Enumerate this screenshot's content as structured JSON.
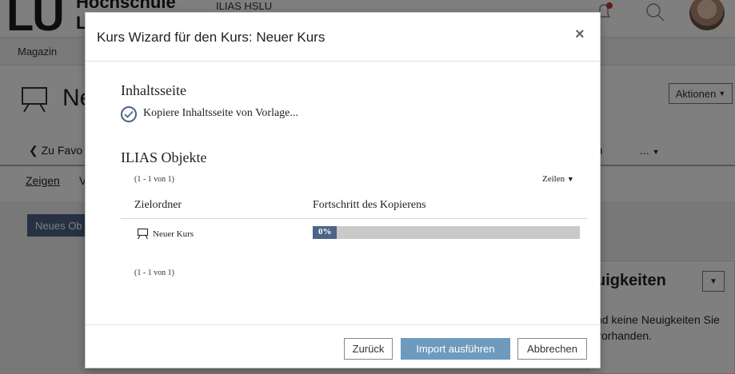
{
  "background": {
    "logo_main": "LU",
    "logo_sub_line1": "Hochschule",
    "logo_sub_line2": "L",
    "topnav_text": "ILIAS HSLU",
    "breadcrumb": "Magazin",
    "course_title": "Ne",
    "actions_label": "Aktionen",
    "tab_back_label": "Zu Favo",
    "tab_partial_label": "en",
    "tab_more_label": "...",
    "subtab_show": "Zeigen",
    "subtab_v": "V",
    "new_object_label": "Neues Ob",
    "news_title": "uigkeiten",
    "news_text": "nd keine Neuigkeiten Sie vorhanden."
  },
  "modal": {
    "title": "Kurs Wizard für den Kurs: Neuer Kurs",
    "close_symbol": "×",
    "content_page_heading": "Inhaltsseite",
    "content_page_status": "Kopiere Inhaltsseite von Vorlage...",
    "objects_heading": "ILIAS Objekte",
    "range_top": "(1 - 1 von 1)",
    "rows_dropdown": "Zeilen",
    "columns": [
      "Zielordner",
      "Fortschritt des Kopierens"
    ],
    "rows": [
      {
        "name": "Neuer Kurs",
        "progress_label": "0%",
        "progress": 0
      }
    ],
    "range_bottom": "(1 - 1 von 1)",
    "buttons": {
      "back": "Zurück",
      "import": "Import ausführen",
      "cancel": "Abbrechen"
    },
    "colors": {
      "accent": "#4c6586",
      "import_button": "#6e9abd",
      "progress_track": "#c9c9c9"
    }
  }
}
